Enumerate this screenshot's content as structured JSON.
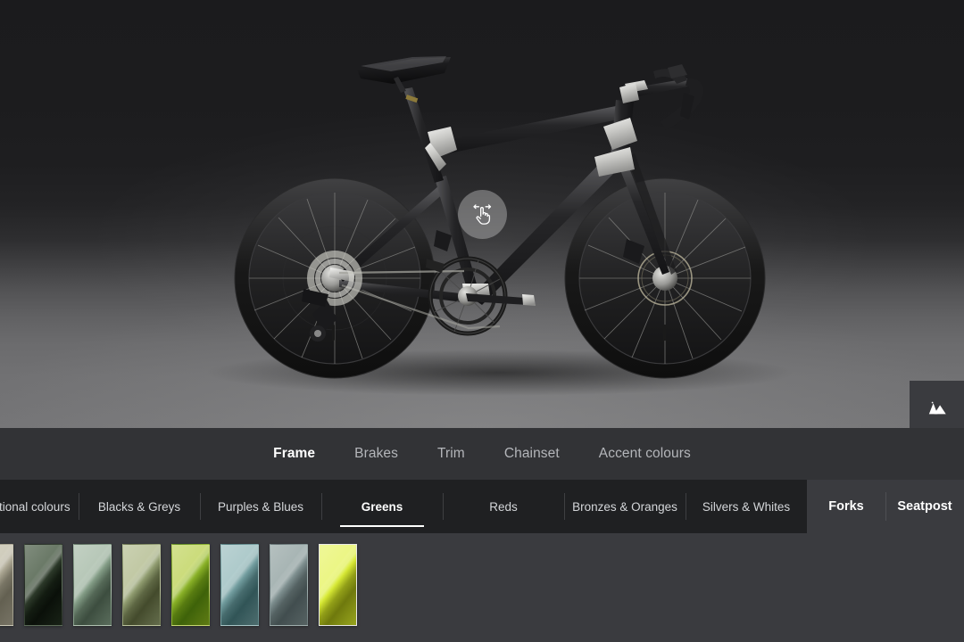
{
  "viewport": {
    "product_name": "road-bike",
    "rotate_hint_label": "drag-to-rotate",
    "bg_toggle_label": "background-toggle"
  },
  "part_tabs": {
    "items": [
      {
        "label": "Frame",
        "active": true
      },
      {
        "label": "Brakes",
        "active": false
      },
      {
        "label": "Trim",
        "active": false
      },
      {
        "label": "Chainset",
        "active": false
      },
      {
        "label": "Accent colours",
        "active": false
      }
    ]
  },
  "category_tabs": {
    "items": [
      {
        "label": "Additional colours",
        "active": false,
        "clipped": true
      },
      {
        "label": "Blacks & Greys",
        "active": false,
        "clipped": false
      },
      {
        "label": "Purples & Blues",
        "active": false,
        "clipped": false
      },
      {
        "label": "Greens",
        "active": true,
        "clipped": false
      },
      {
        "label": "Reds",
        "active": false,
        "clipped": false
      },
      {
        "label": "Bronzes & Oranges",
        "active": false,
        "clipped": false
      },
      {
        "label": "Silvers & Whites",
        "active": false,
        "clipped": false
      }
    ],
    "extra": [
      {
        "label": "Forks"
      },
      {
        "label": "Seatpost"
      }
    ]
  },
  "swatches": {
    "items": [
      {
        "name": "khaki-sand",
        "base": "#a9a48f",
        "light": "#c6c2ae",
        "dark": "#7e7a67",
        "selected": false
      },
      {
        "name": "deep-forest",
        "base": "#22301f",
        "light": "#4a5c46",
        "dark": "#0d140c",
        "selected": false
      },
      {
        "name": "sage-green",
        "base": "#7f9a82",
        "light": "#a8bca9",
        "dark": "#4d6250",
        "selected": false
      },
      {
        "name": "olive-sage",
        "base": "#8d9a6b",
        "light": "#b4bd91",
        "dark": "#565f38",
        "selected": false
      },
      {
        "name": "apple-green",
        "base": "#86af1c",
        "light": "#c0d45f",
        "dark": "#4f7d0c",
        "selected": false
      },
      {
        "name": "teal-green",
        "base": "#6d9a9c",
        "light": "#9dbfc0",
        "dark": "#3e6b6e",
        "selected": false
      },
      {
        "name": "slate-grey-green",
        "base": "#7a8c8c",
        "light": "#95a5a4",
        "dark": "#536264",
        "selected": false
      },
      {
        "name": "acid-lime",
        "base": "#d7ea2a",
        "light": "#e8f46b",
        "dark": "#8d9a10",
        "selected": true
      }
    ]
  },
  "colors": {
    "panel_dark": "#1f2022",
    "panel_mid": "#323336",
    "panel_light": "#3a3b3f",
    "accent_white": "#ffffff",
    "text_muted": "#b4b6ba"
  }
}
